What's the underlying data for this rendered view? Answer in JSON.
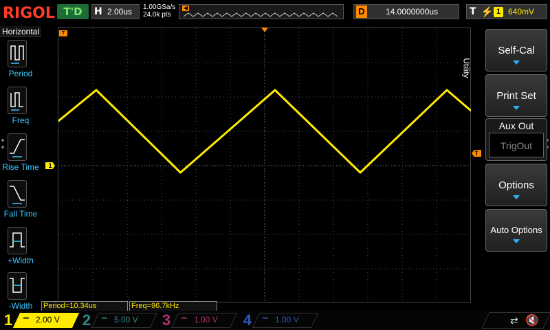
{
  "header": {
    "brand": "RIGOL",
    "run_state": "T'D",
    "horizontal": {
      "key": "H",
      "timebase": "2.00us"
    },
    "sample_rate": "1.00GSa/s",
    "memory_depth": "24.0k pts",
    "delay": {
      "key": "D",
      "value": "14.0000000us"
    },
    "trigger": {
      "key": "T",
      "edge_icon": "rising-edge-icon",
      "source": "1",
      "level": "640mV"
    }
  },
  "left_menu": {
    "title": "Horizontal",
    "items": [
      {
        "label": "Period",
        "icon": "period-icon"
      },
      {
        "label": "Freq",
        "icon": "frequency-icon"
      },
      {
        "label": "Rise Time",
        "icon": "rise-time-icon"
      },
      {
        "label": "Fall Time",
        "icon": "fall-time-icon"
      },
      {
        "label": "+Width",
        "icon": "positive-width-icon"
      },
      {
        "label": "-Width",
        "icon": "negative-width-icon"
      }
    ]
  },
  "markers": {
    "channel_marker": "1",
    "trigger_marker": "T",
    "top_left_marker": "T"
  },
  "measurements": {
    "period": "Period=10.34us",
    "freq": "Freq=96.7kHz"
  },
  "right_menu": {
    "tab": "Utility",
    "buttons": [
      {
        "label": "Self-Cal"
      },
      {
        "label": "Print Set"
      }
    ],
    "aux_out": {
      "label": "Aux Out",
      "value": "TrigOut"
    },
    "buttons2": [
      {
        "label": "Options"
      },
      {
        "label": "Auto Options"
      }
    ]
  },
  "channels": [
    {
      "num": "1",
      "scale": "2.00 V",
      "color": "#ffeb00"
    },
    {
      "num": "2",
      "scale": "5.00 V",
      "color": "#2c8a8a"
    },
    {
      "num": "3",
      "scale": "1.00 V",
      "color": "#b0306e"
    },
    {
      "num": "4",
      "scale": "1.00 V",
      "color": "#2f55c0"
    }
  ],
  "status": {
    "usb_icon": "usb-icon",
    "speaker_icon": "speaker-muted-icon"
  },
  "colors": {
    "trace": "#ffeb00",
    "trigger": "#ff8a00",
    "accent": "#2cb4ff"
  },
  "chart_data": {
    "type": "line",
    "title": "",
    "xlabel": "",
    "ylabel": "",
    "grid": true,
    "grid_divisions": {
      "x": 12,
      "y": 8
    },
    "xlim_div": [
      -6,
      6
    ],
    "ylim_div": [
      -4,
      4
    ],
    "series": [
      {
        "x_div": [
          -6.0,
          -4.9,
          -2.45,
          0.3,
          2.78,
          5.3,
          6.0
        ],
        "y_div": [
          1.3,
          2.2,
          -0.2,
          2.2,
          -0.2,
          2.2,
          1.6
        ]
      }
    ]
  }
}
